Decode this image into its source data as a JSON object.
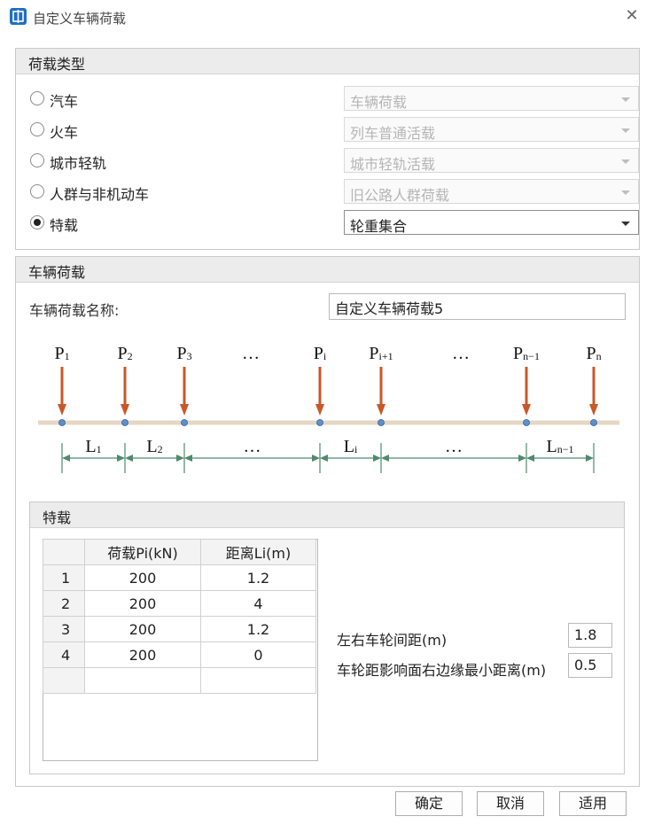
{
  "window": {
    "title": "自定义车辆荷载",
    "close_glyph": "✕"
  },
  "load_type": {
    "header": "荷载类型",
    "options": [
      {
        "label": "汽车",
        "selected": false,
        "combo": "车辆荷载",
        "enabled": false
      },
      {
        "label": "火车",
        "selected": false,
        "combo": "列车普通活载",
        "enabled": false
      },
      {
        "label": "城市轻轨",
        "selected": false,
        "combo": "城市轻轨活载",
        "enabled": false
      },
      {
        "label": "人群与非机动车",
        "selected": false,
        "combo": "旧公路人群荷载",
        "enabled": false
      },
      {
        "label": "特载",
        "selected": true,
        "combo": "轮重集合",
        "enabled": true
      }
    ]
  },
  "vehicle": {
    "header": "车辆荷载",
    "name_label": "车辆荷载名称:",
    "name_value": "自定义车辆荷载5",
    "diagram": {
      "loads": [
        {
          "base": "P",
          "sub": "1"
        },
        {
          "base": "P",
          "sub": "2"
        },
        {
          "base": "P",
          "sub": "3"
        },
        {
          "base": "…",
          "sub": ""
        },
        {
          "base": "P",
          "sub": "i"
        },
        {
          "base": "P",
          "sub": "i+1"
        },
        {
          "base": "…",
          "sub": ""
        },
        {
          "base": "P",
          "sub": "n−1"
        },
        {
          "base": "P",
          "sub": "n"
        }
      ],
      "spans": [
        {
          "base": "L",
          "sub": "1"
        },
        {
          "base": "L",
          "sub": "2"
        },
        {
          "base": "…",
          "sub": ""
        },
        {
          "base": "L",
          "sub": "i"
        },
        {
          "base": "…",
          "sub": ""
        },
        {
          "base": "L",
          "sub": "n−1"
        }
      ],
      "colors": {
        "arrow": "#c8582a",
        "beam": "#e6d7c3",
        "node": "#5b8fcf",
        "dim": "#4e8a6e"
      }
    }
  },
  "special": {
    "header": "特载",
    "columns": [
      "荷载Pi(kN)",
      "距离Li(m)"
    ],
    "rows": [
      {
        "index": "1",
        "load": "200",
        "dist": "1.2"
      },
      {
        "index": "2",
        "load": "200",
        "dist": "4"
      },
      {
        "index": "3",
        "load": "200",
        "dist": "1.2"
      },
      {
        "index": "4",
        "load": "200",
        "dist": "0"
      },
      {
        "index": "",
        "load": "",
        "dist": ""
      }
    ],
    "wheel_spacing_label": "左右车轮间距(m)",
    "wheel_spacing_value": "1.8",
    "min_edge_label": "车轮距影响面右边缘最小距离(m)",
    "min_edge_value": "0.5"
  },
  "buttons": {
    "ok": "确定",
    "cancel": "取消",
    "apply": "适用"
  }
}
